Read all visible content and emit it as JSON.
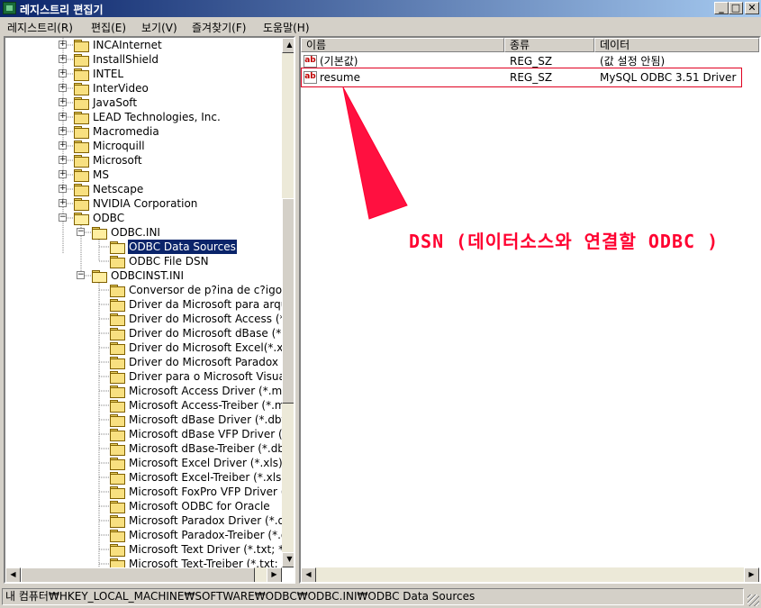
{
  "window": {
    "title": "레지스트리 편집기",
    "minimize": "_",
    "maximize": "□",
    "close": "✕"
  },
  "menu": [
    "레지스트리(R)",
    "편집(E)",
    "보기(V)",
    "즐겨찾기(F)",
    "도움말(H)"
  ],
  "tree": [
    {
      "label": "INCAInternet",
      "level": 0,
      "exp": "+"
    },
    {
      "label": "InstallShield",
      "level": 0,
      "exp": "+"
    },
    {
      "label": "INTEL",
      "level": 0,
      "exp": "+"
    },
    {
      "label": "InterVideo",
      "level": 0,
      "exp": "+"
    },
    {
      "label": "JavaSoft",
      "level": 0,
      "exp": "+"
    },
    {
      "label": "LEAD Technologies, Inc.",
      "level": 0,
      "exp": "+"
    },
    {
      "label": "Macromedia",
      "level": 0,
      "exp": "+"
    },
    {
      "label": "Microquill",
      "level": 0,
      "exp": "+"
    },
    {
      "label": "Microsoft",
      "level": 0,
      "exp": "+"
    },
    {
      "label": "MS",
      "level": 0,
      "exp": "+"
    },
    {
      "label": "Netscape",
      "level": 0,
      "exp": "+"
    },
    {
      "label": "NVIDIA Corporation",
      "level": 0,
      "exp": "+"
    },
    {
      "label": "ODBC",
      "level": 0,
      "exp": "-"
    },
    {
      "label": "ODBC.INI",
      "level": 1,
      "exp": "-"
    },
    {
      "label": "ODBC Data Sources",
      "level": 2,
      "exp": "",
      "selected": true
    },
    {
      "label": "ODBC File DSN",
      "level": 2,
      "exp": ""
    },
    {
      "label": "ODBCINST.INI",
      "level": 1,
      "exp": "-"
    },
    {
      "label": "Conversor de p?ina de c?igo MS",
      "level": 2,
      "exp": ""
    },
    {
      "label": "Driver da Microsoft para arquivos",
      "level": 2,
      "exp": ""
    },
    {
      "label": "Driver do Microsoft Access (*.mdb)",
      "level": 2,
      "exp": ""
    },
    {
      "label": "Driver do Microsoft dBase (*.dbf)",
      "level": 2,
      "exp": ""
    },
    {
      "label": "Driver do Microsoft Excel(*.xls)",
      "level": 2,
      "exp": ""
    },
    {
      "label": "Driver do Microsoft Paradox (*.db)",
      "level": 2,
      "exp": ""
    },
    {
      "label": "Driver para o Microsoft Visual FoxPro",
      "level": 2,
      "exp": ""
    },
    {
      "label": "Microsoft Access Driver (*.mdb)",
      "level": 2,
      "exp": ""
    },
    {
      "label": "Microsoft Access-Treiber (*.mdb)",
      "level": 2,
      "exp": ""
    },
    {
      "label": "Microsoft dBase Driver (*.dbf)",
      "level": 2,
      "exp": ""
    },
    {
      "label": "Microsoft dBase VFP Driver (*.dbf)",
      "level": 2,
      "exp": ""
    },
    {
      "label": "Microsoft dBase-Treiber (*.dbf)",
      "level": 2,
      "exp": ""
    },
    {
      "label": "Microsoft Excel Driver (*.xls)",
      "level": 2,
      "exp": ""
    },
    {
      "label": "Microsoft Excel-Treiber (*.xls)",
      "level": 2,
      "exp": ""
    },
    {
      "label": "Microsoft FoxPro VFP Driver (*.dbf)",
      "level": 2,
      "exp": ""
    },
    {
      "label": "Microsoft ODBC for Oracle",
      "level": 2,
      "exp": ""
    },
    {
      "label": "Microsoft Paradox Driver (*.db )",
      "level": 2,
      "exp": ""
    },
    {
      "label": "Microsoft Paradox-Treiber (*.db )",
      "level": 2,
      "exp": ""
    },
    {
      "label": "Microsoft Text Driver (*.txt; *.csv)",
      "level": 2,
      "exp": ""
    },
    {
      "label": "Microsoft Text-Treiber (*.txt; *.csv)",
      "level": 2,
      "exp": ""
    }
  ],
  "list": {
    "columns": [
      "이름",
      "종류",
      "데이터"
    ],
    "rows": [
      {
        "name": "(기본값)",
        "type": "REG_SZ",
        "data": "(값 설정 안됨)"
      },
      {
        "name": "resume",
        "type": "REG_SZ",
        "data": "MySQL ODBC 3.51 Driver"
      }
    ]
  },
  "annotation": "DSN (데이터소스와 연결할 ODBC )",
  "status": "내 컴퓨터₩HKEY_LOCAL_MACHINE₩SOFTWARE₩ODBC₩ODBC.INI₩ODBC Data Sources",
  "colors": {
    "accent": "#0a246a",
    "annotation": "#ff0030"
  }
}
